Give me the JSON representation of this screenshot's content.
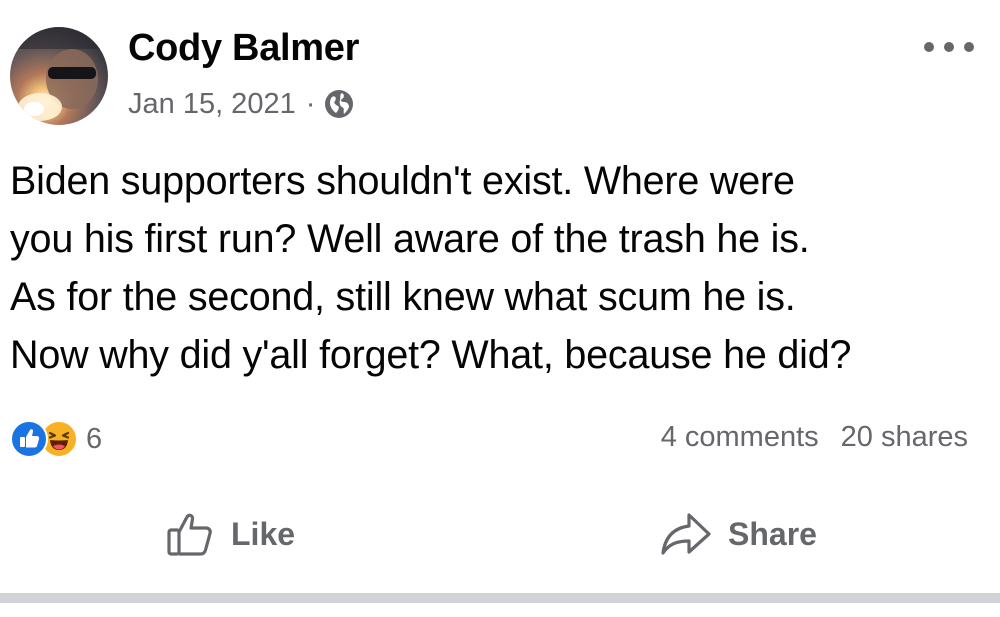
{
  "post": {
    "author": "Cody Balmer",
    "date": "Jan 15, 2021",
    "separator": "·",
    "privacy_icon": "globe-icon",
    "text_lines": [
      "Biden supporters shouldn't exist. Where were",
      "you his first run? Well aware of the trash he is.",
      "As for the second, still knew what scum he is.",
      "Now why did y'all forget? What, because he did?"
    ],
    "reactions": {
      "types": [
        "like",
        "haha"
      ],
      "count": "6"
    },
    "comments": "4 comments",
    "shares": "20 shares"
  },
  "actions": {
    "like_label": "Like",
    "share_label": "Share"
  },
  "colors": {
    "text": "#050505",
    "secondary": "#65676b",
    "like_blue": "#1b74e4",
    "haha_yellow": "#f7b125",
    "divider": "#d0d2d6"
  }
}
